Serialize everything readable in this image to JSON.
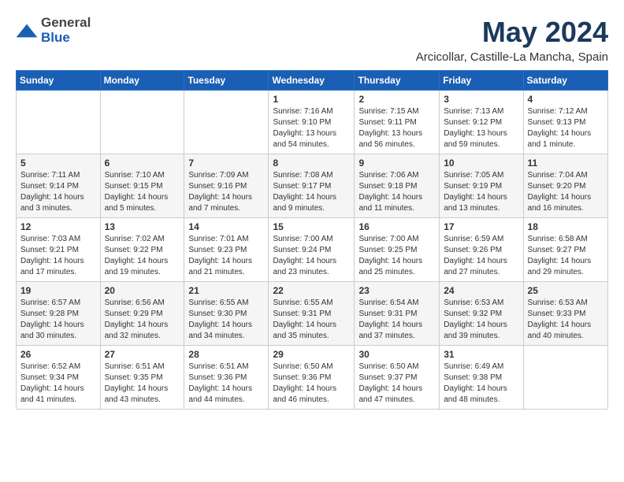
{
  "header": {
    "logo_general": "General",
    "logo_blue": "Blue",
    "month_title": "May 2024",
    "location": "Arcicollar, Castille-La Mancha, Spain"
  },
  "weekdays": [
    "Sunday",
    "Monday",
    "Tuesday",
    "Wednesday",
    "Thursday",
    "Friday",
    "Saturday"
  ],
  "weeks": [
    [
      {
        "day": "",
        "detail": ""
      },
      {
        "day": "",
        "detail": ""
      },
      {
        "day": "",
        "detail": ""
      },
      {
        "day": "1",
        "detail": "Sunrise: 7:16 AM\nSunset: 9:10 PM\nDaylight: 13 hours\nand 54 minutes."
      },
      {
        "day": "2",
        "detail": "Sunrise: 7:15 AM\nSunset: 9:11 PM\nDaylight: 13 hours\nand 56 minutes."
      },
      {
        "day": "3",
        "detail": "Sunrise: 7:13 AM\nSunset: 9:12 PM\nDaylight: 13 hours\nand 59 minutes."
      },
      {
        "day": "4",
        "detail": "Sunrise: 7:12 AM\nSunset: 9:13 PM\nDaylight: 14 hours\nand 1 minute."
      }
    ],
    [
      {
        "day": "5",
        "detail": "Sunrise: 7:11 AM\nSunset: 9:14 PM\nDaylight: 14 hours\nand 3 minutes."
      },
      {
        "day": "6",
        "detail": "Sunrise: 7:10 AM\nSunset: 9:15 PM\nDaylight: 14 hours\nand 5 minutes."
      },
      {
        "day": "7",
        "detail": "Sunrise: 7:09 AM\nSunset: 9:16 PM\nDaylight: 14 hours\nand 7 minutes."
      },
      {
        "day": "8",
        "detail": "Sunrise: 7:08 AM\nSunset: 9:17 PM\nDaylight: 14 hours\nand 9 minutes."
      },
      {
        "day": "9",
        "detail": "Sunrise: 7:06 AM\nSunset: 9:18 PM\nDaylight: 14 hours\nand 11 minutes."
      },
      {
        "day": "10",
        "detail": "Sunrise: 7:05 AM\nSunset: 9:19 PM\nDaylight: 14 hours\nand 13 minutes."
      },
      {
        "day": "11",
        "detail": "Sunrise: 7:04 AM\nSunset: 9:20 PM\nDaylight: 14 hours\nand 16 minutes."
      }
    ],
    [
      {
        "day": "12",
        "detail": "Sunrise: 7:03 AM\nSunset: 9:21 PM\nDaylight: 14 hours\nand 17 minutes."
      },
      {
        "day": "13",
        "detail": "Sunrise: 7:02 AM\nSunset: 9:22 PM\nDaylight: 14 hours\nand 19 minutes."
      },
      {
        "day": "14",
        "detail": "Sunrise: 7:01 AM\nSunset: 9:23 PM\nDaylight: 14 hours\nand 21 minutes."
      },
      {
        "day": "15",
        "detail": "Sunrise: 7:00 AM\nSunset: 9:24 PM\nDaylight: 14 hours\nand 23 minutes."
      },
      {
        "day": "16",
        "detail": "Sunrise: 7:00 AM\nSunset: 9:25 PM\nDaylight: 14 hours\nand 25 minutes."
      },
      {
        "day": "17",
        "detail": "Sunrise: 6:59 AM\nSunset: 9:26 PM\nDaylight: 14 hours\nand 27 minutes."
      },
      {
        "day": "18",
        "detail": "Sunrise: 6:58 AM\nSunset: 9:27 PM\nDaylight: 14 hours\nand 29 minutes."
      }
    ],
    [
      {
        "day": "19",
        "detail": "Sunrise: 6:57 AM\nSunset: 9:28 PM\nDaylight: 14 hours\nand 30 minutes."
      },
      {
        "day": "20",
        "detail": "Sunrise: 6:56 AM\nSunset: 9:29 PM\nDaylight: 14 hours\nand 32 minutes."
      },
      {
        "day": "21",
        "detail": "Sunrise: 6:55 AM\nSunset: 9:30 PM\nDaylight: 14 hours\nand 34 minutes."
      },
      {
        "day": "22",
        "detail": "Sunrise: 6:55 AM\nSunset: 9:31 PM\nDaylight: 14 hours\nand 35 minutes."
      },
      {
        "day": "23",
        "detail": "Sunrise: 6:54 AM\nSunset: 9:31 PM\nDaylight: 14 hours\nand 37 minutes."
      },
      {
        "day": "24",
        "detail": "Sunrise: 6:53 AM\nSunset: 9:32 PM\nDaylight: 14 hours\nand 39 minutes."
      },
      {
        "day": "25",
        "detail": "Sunrise: 6:53 AM\nSunset: 9:33 PM\nDaylight: 14 hours\nand 40 minutes."
      }
    ],
    [
      {
        "day": "26",
        "detail": "Sunrise: 6:52 AM\nSunset: 9:34 PM\nDaylight: 14 hours\nand 41 minutes."
      },
      {
        "day": "27",
        "detail": "Sunrise: 6:51 AM\nSunset: 9:35 PM\nDaylight: 14 hours\nand 43 minutes."
      },
      {
        "day": "28",
        "detail": "Sunrise: 6:51 AM\nSunset: 9:36 PM\nDaylight: 14 hours\nand 44 minutes."
      },
      {
        "day": "29",
        "detail": "Sunrise: 6:50 AM\nSunset: 9:36 PM\nDaylight: 14 hours\nand 46 minutes."
      },
      {
        "day": "30",
        "detail": "Sunrise: 6:50 AM\nSunset: 9:37 PM\nDaylight: 14 hours\nand 47 minutes."
      },
      {
        "day": "31",
        "detail": "Sunrise: 6:49 AM\nSunset: 9:38 PM\nDaylight: 14 hours\nand 48 minutes."
      },
      {
        "day": "",
        "detail": ""
      }
    ]
  ]
}
